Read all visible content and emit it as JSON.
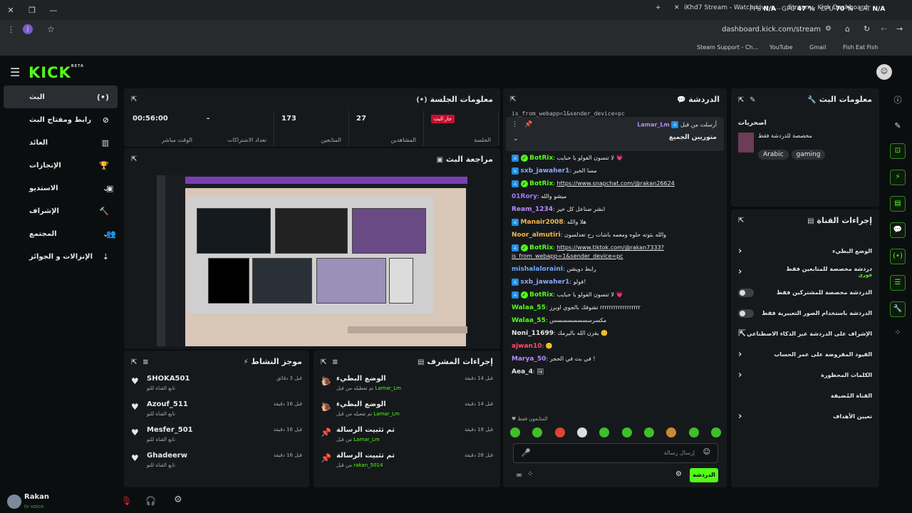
{
  "browser": {
    "tabs": [
      "iKhd7 Stream - Watch Live o...",
      "Stream - Kick Dashboard"
    ],
    "perf": [
      {
        "k": "FPS",
        "v": "N/A"
      },
      {
        "k": "GPU",
        "v": "47 %"
      },
      {
        "k": "CPU",
        "v": "70 %"
      },
      {
        "k": "LAT",
        "v": "N/A"
      }
    ],
    "url": "dashboard.kick.com/stream",
    "profile_initial": "J",
    "bookmarks": [
      "Steam Support - Ch...",
      "YouTube",
      "Gmail",
      "Fish Eat Fish"
    ]
  },
  "brand": {
    "logo": "KICK",
    "beta": "BETA"
  },
  "sidebar": [
    {
      "label": "البث",
      "icon": "(•)",
      "active": true
    },
    {
      "label": "رابط ومفتاح البث",
      "icon": "⊘"
    },
    {
      "label": "العائد",
      "icon": "▥"
    },
    {
      "label": "الإنجازات",
      "icon": "🏆"
    },
    {
      "label": "الاستديو",
      "icon": "⌄",
      "extra": "▣"
    },
    {
      "label": "الإشراف",
      "icon": "🔨"
    },
    {
      "label": "المجتمع",
      "icon": "⌄",
      "extra": "👥"
    },
    {
      "label": "الإنزالات و الجوائز",
      "icon": "⇣"
    }
  ],
  "session": {
    "title": "معلومات الجلسة",
    "stats": [
      {
        "value": "جار البث",
        "key": "الجلسة",
        "live": true
      },
      {
        "value": "27",
        "key": "المشاهدين"
      },
      {
        "value": "173",
        "key": "المتابعين"
      },
      {
        "value": "-",
        "key": "تعداد الاشتراكات"
      },
      {
        "value": "00:56:00",
        "key": "الوقت مباشر"
      }
    ]
  },
  "preview": {
    "title": "مراجعة البث"
  },
  "activity": {
    "title": "موجز النشاط",
    "items": [
      {
        "name": "SHOKA501",
        "sub": "تابع القناة للتو",
        "time": "قبل 3 دقائق"
      },
      {
        "name": "Azouf_511",
        "sub": "تابع القناة للتو",
        "time": "قبل 16 دقيقة"
      },
      {
        "name": "Mesfer_501",
        "sub": "تابع القناة للتو",
        "time": "قبل 16 دقيقة"
      },
      {
        "name": "Ghadeerw",
        "sub": "تابع القناة للتو",
        "time": "قبل 16 دقيقة"
      }
    ]
  },
  "modactions": {
    "title": "إجراءات المشرف",
    "items": [
      {
        "action": "الوضع البطيء",
        "by": "تم تعطيله من قبل",
        "who": "Lamar_Lm",
        "time": "قبل 14 دقيقة",
        "icon": "🐌"
      },
      {
        "action": "الوضع البطيء",
        "by": "تم تفعيله من قبل",
        "who": "Lamar_Lm",
        "time": "قبل 14 دقيقة",
        "icon": "🐌"
      },
      {
        "action": "تم تثبيت الرسالة",
        "by": "من قبل",
        "who": "Lamar_Lm",
        "time": "قبل 18 دقيقة",
        "icon": "📌"
      },
      {
        "action": "تم تثبيت الرسالة",
        "by": "من قبل",
        "who": "rakan_5014",
        "time": "قبل 28 دقيقة",
        "icon": "📌"
      }
    ]
  },
  "chat": {
    "title": "الدردشة",
    "cut_line": "is_from_webapp=1&sender_device=pc",
    "pinned": {
      "by_label": "أرسلت من قبل",
      "user": "Lamar_Lm",
      "text": "متوريين الجميع"
    },
    "messages": [
      {
        "user": "BotRix",
        "color": "#53fc18",
        "text": "لا تنسون الفولو يا حبايب 💗",
        "bot": true
      },
      {
        "user": "sxb_jawaher1",
        "color": "#8ea8ff",
        "text": "مسا الخير",
        "badge": true
      },
      {
        "user": "BotRix",
        "color": "#53fc18",
        "text": "https://www.snapchat.com/@rakan26624",
        "bot": true,
        "link": true
      },
      {
        "user": "01Rory",
        "color": "#a07cff",
        "text": "ميشو والله"
      },
      {
        "user": "Ream_1234",
        "color": "#b98cff",
        "text": "ابشر صناعل كل خير"
      },
      {
        "user": "Manair2008",
        "color": "#f2b84b",
        "text": "هلا والله",
        "badge": true
      },
      {
        "user": "Noor_almutiri",
        "color": "#f2b84b",
        "text": "والله بثوته حلوه ومعمه باشات رح تعدلسون"
      },
      {
        "user": "BotRix",
        "color": "#53fc18",
        "text": "https://www.tiktok.com/@rakan7333?is_from_webapp=1&sender_device=pc",
        "bot": true,
        "link": true
      },
      {
        "user": "mishalalorainI",
        "color": "#6fa8ff",
        "text": "رابط دويشن"
      },
      {
        "user": "sxb_jawaher1",
        "color": "#8ea8ff",
        "text": "فولو!",
        "badge": true
      },
      {
        "user": "BotRix",
        "color": "#53fc18",
        "text": "لا تنسون الفولو يا حبايب 💗",
        "bot": true
      },
      {
        "user": "Walaa_55",
        "color": "#53fc18",
        "text": "تشوفك بالجوي اوبرز rrrrrrrrrrrrrrrrrr"
      },
      {
        "user": "Walaa_55",
        "color": "#53fc18",
        "text": "مكسرسسسسسسسس"
      },
      {
        "user": "Noni_11699",
        "color": "#e6e6e6",
        "text": "يقزن الله باليرمك 🙂"
      },
      {
        "user": "ajwan10",
        "color": "#ff4d6d",
        "text": "🙂"
      },
      {
        "user": "Marya_50",
        "color": "#b98cff",
        "text": "في بث في الحجر !"
      },
      {
        "user": "Aea_4",
        "color": "#e6e6e6",
        "text": "🖼"
      }
    ],
    "followers_only": "المتابعون فقط",
    "input_placeholder": "إرسال رسالة",
    "send_label": "الدردشة"
  },
  "streaminfo": {
    "title": "معلومات البث",
    "category": "اصحربات",
    "desc": "مخصصة للدردشة فقط",
    "tags": [
      "Arabic",
      "gaming"
    ]
  },
  "channelactions": {
    "title": "إجراءات القناة",
    "rows": [
      {
        "label": "الوضع البطيء",
        "type": "chev"
      },
      {
        "label": "دردشة مخصصة للمتابعين فقط",
        "sub": "فوري",
        "type": "chev"
      },
      {
        "label": "الدردشة مخصصة للمشتركين فقط",
        "type": "toggle"
      },
      {
        "label": "الدردشة باستخدام الصور التعبيرية فقط",
        "type": "toggle"
      },
      {
        "label": "الإشراف على الدردشة عبر الذكاء الاصطناعي",
        "type": "ext"
      },
      {
        "label": "القيود المفروضة على عمر الحساب",
        "type": "chev"
      },
      {
        "label": "الكلمات المحظورة",
        "type": "chev"
      },
      {
        "label": "القناة المُضيفة",
        "type": "none"
      },
      {
        "label": "تعيين الأهداف",
        "type": "chev"
      }
    ]
  },
  "bottom": {
    "user": "Rakan",
    "status": "In voice"
  }
}
